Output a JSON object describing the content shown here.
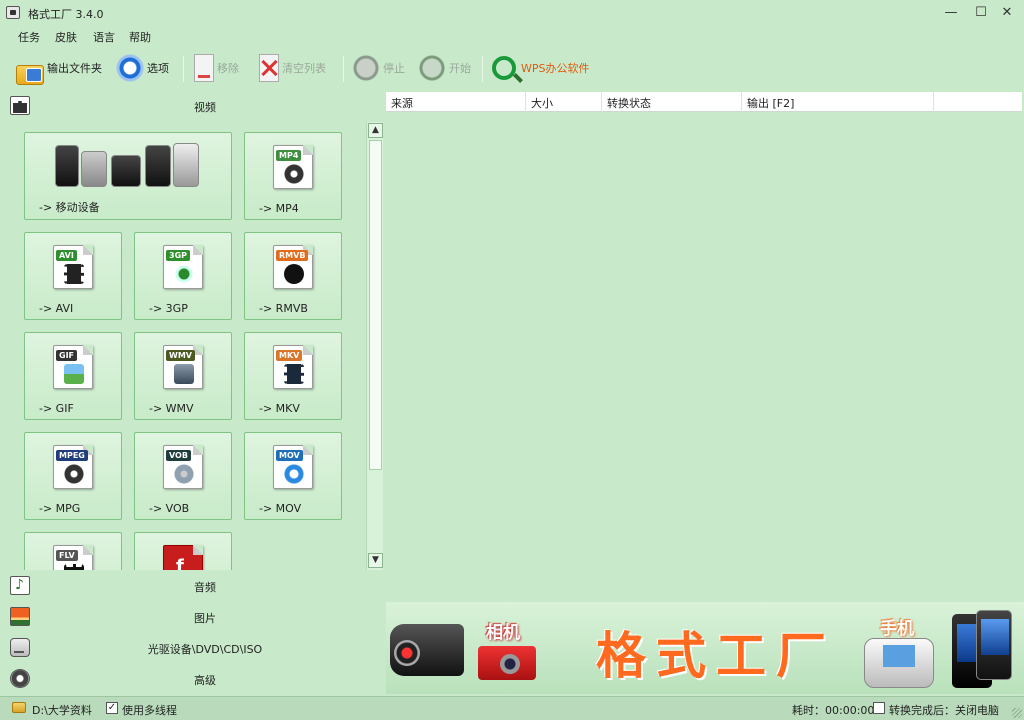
{
  "window": {
    "title": "格式工厂 3.4.0",
    "minimize": "—",
    "maximize": "☐",
    "close": "✕"
  },
  "menu": [
    "任务",
    "皮肤",
    "语言",
    "帮助"
  ],
  "toolbar": {
    "output_folder": "输出文件夹",
    "options": "选项",
    "remove": "移除",
    "clear_list": "清空列表",
    "stop": "停止",
    "start": "开始",
    "wps": "WPS办公软件"
  },
  "sections": {
    "video": "视频",
    "audio": "音频",
    "picture": "图片",
    "disc": "光驱设备\\DVD\\CD\\ISO",
    "advanced": "高级"
  },
  "formats": [
    {
      "label": "-> 移动设备",
      "tag": "",
      "color": ""
    },
    {
      "label": "-> MP4",
      "tag": "MP4",
      "color": "#3e8f3e"
    },
    {
      "label": "-> AVI",
      "tag": "AVI",
      "color": "#2f8f2f"
    },
    {
      "label": "-> 3GP",
      "tag": "3GP",
      "color": "#2f8f2f"
    },
    {
      "label": "-> RMVB",
      "tag": "RMVB",
      "color": "#e06c1c"
    },
    {
      "label": "-> GIF",
      "tag": "GIF",
      "color": "#333333"
    },
    {
      "label": "-> WMV",
      "tag": "WMV",
      "color": "#4a5a20"
    },
    {
      "label": "-> MKV",
      "tag": "MKV",
      "color": "#d9762a"
    },
    {
      "label": "-> MPG",
      "tag": "MPEG",
      "color": "#1f3d7a"
    },
    {
      "label": "-> VOB",
      "tag": "VOB",
      "color": "#1f3d3d"
    },
    {
      "label": "-> MOV",
      "tag": "MOV",
      "color": "#1f6fb8"
    },
    {
      "label": "",
      "tag": "FLV",
      "color": "#555555"
    },
    {
      "label": "",
      "tag": "",
      "color": "#c81d1d"
    }
  ],
  "table": {
    "columns": [
      "来源",
      "大小",
      "转换状态",
      "输出 [F2]"
    ]
  },
  "banner": {
    "camera_label": "相机",
    "title": "格式工厂",
    "phone_label": "手机"
  },
  "status": {
    "output_path": "D:\\大学资料",
    "multithread_label": "使用多线程",
    "multithread_checked": "✓",
    "elapsed": "耗时：00:00:00",
    "shutdown_label": "转换完成后：关闭电脑"
  }
}
